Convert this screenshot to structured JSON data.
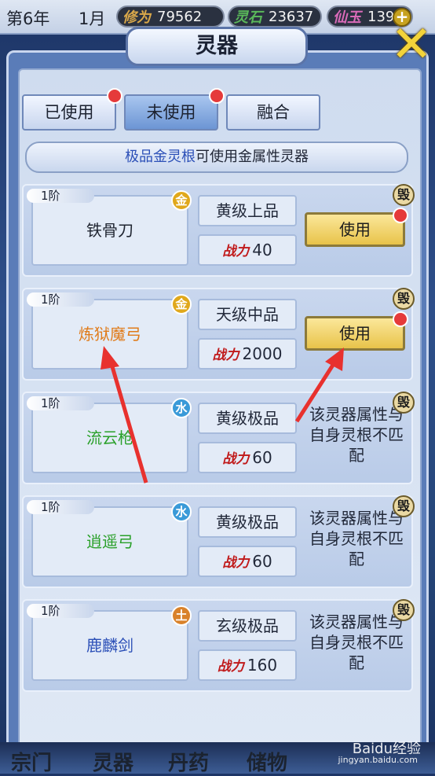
{
  "topbar": {
    "year": "第6年",
    "month": "1月",
    "resources": [
      {
        "label": "修为",
        "value": "79562",
        "color": "#d9a84a"
      },
      {
        "label": "灵石",
        "value": "23637",
        "color": "#5ab85a"
      },
      {
        "label": "仙玉",
        "value": "1392",
        "color": "#d96ab8"
      }
    ],
    "add_label": "+"
  },
  "title": "灵器",
  "tabs": [
    {
      "label": "已使用",
      "active": false,
      "badge": true
    },
    {
      "label": "未使用",
      "active": true,
      "badge": true
    },
    {
      "label": "融合",
      "active": false,
      "badge": false
    }
  ],
  "hint": {
    "highlight": "极品金灵根",
    "rest": "可使用金属性灵器"
  },
  "items": [
    {
      "tier": "1阶",
      "name": "铁骨刀",
      "name_color": "#1f2430",
      "element": "金",
      "element_color": "#e0a81c",
      "grade": "黄级上品",
      "power_label": "战力",
      "power": "40",
      "action": "使用",
      "badge": true,
      "destroy": "毁"
    },
    {
      "tier": "1阶",
      "name": "炼狱魔弓",
      "name_color": "#e07b1a",
      "element": "金",
      "element_color": "#e0a81c",
      "grade": "天级中品",
      "power_label": "战力",
      "power": "2000",
      "action": "使用",
      "badge": true,
      "destroy": "毁"
    },
    {
      "tier": "1阶",
      "name": "流云枪",
      "name_color": "#2aa02a",
      "element": "水",
      "element_color": "#3a9ad8",
      "grade": "黄级极品",
      "power_label": "战力",
      "power": "60",
      "mismatch": "该灵器属性与自身灵根不匹配",
      "destroy": "毁"
    },
    {
      "tier": "1阶",
      "name": "逍遥弓",
      "name_color": "#2aa02a",
      "element": "水",
      "element_color": "#3a9ad8",
      "grade": "黄级极品",
      "power_label": "战力",
      "power": "60",
      "mismatch": "该灵器属性与自身灵根不匹配",
      "destroy": "毁"
    },
    {
      "tier": "1阶",
      "name": "鹿麟剑",
      "name_color": "#2b4fb7",
      "element": "土",
      "element_color": "#d9822b",
      "grade": "玄级极品",
      "power_label": "战力",
      "power": "160",
      "mismatch": "该灵器属性与自身灵根不匹配",
      "destroy": "毁"
    }
  ],
  "bottom_nav": [
    "宗门",
    "灵器",
    "丹药",
    "储物"
  ],
  "watermark": {
    "brand": "Baidu经验",
    "url": "jingyan.baidu.com"
  }
}
